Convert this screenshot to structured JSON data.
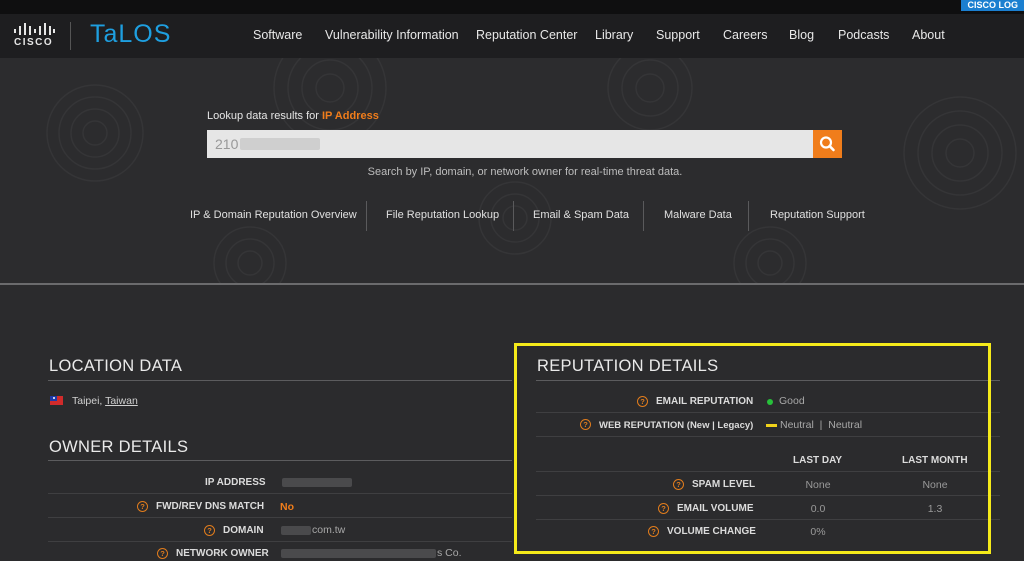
{
  "topbar": {
    "login_label": "CISCO LOG"
  },
  "header": {
    "cisco_wordmark": "CISCO",
    "talos_wordmark": "TaLOS",
    "nav": [
      "Software",
      "Vulnerability Information",
      "Reputation Center",
      "Library",
      "Support",
      "Careers",
      "Blog",
      "Podcasts",
      "About"
    ]
  },
  "lookup": {
    "label_prefix": "Lookup data results for ",
    "label_accent": "IP Address",
    "search_value": "210",
    "hint": "Search by IP, domain, or network owner for real-time threat data."
  },
  "subnav": [
    "IP & Domain Reputation Overview",
    "File Reputation Lookup",
    "Email & Spam Data",
    "Malware Data",
    "Reputation Support"
  ],
  "location": {
    "title": "LOCATION DATA",
    "city": "Taipei, ",
    "country": "Taiwan"
  },
  "owner": {
    "title": "OWNER DETAILS",
    "rows": [
      {
        "label": "IP ADDRESS",
        "value": ""
      },
      {
        "label": "FWD/REV DNS MATCH",
        "value": "No"
      },
      {
        "label": "DOMAIN",
        "value": "com.tw"
      },
      {
        "label": "NETWORK OWNER",
        "value": "s Co."
      }
    ]
  },
  "reputation": {
    "title": "REPUTATION DETAILS",
    "email_label": "EMAIL REPUTATION",
    "email_value": "Good",
    "web_label": "WEB REPUTATION (New | Legacy)",
    "web_value": "Neutral  |  Neutral",
    "columns": [
      "LAST DAY",
      "LAST MONTH"
    ],
    "rows": [
      {
        "label": "SPAM LEVEL",
        "last_day": "None",
        "last_month": "None"
      },
      {
        "label": "EMAIL VOLUME",
        "last_day": "0.0",
        "last_month": "1.3"
      },
      {
        "label": "VOLUME CHANGE",
        "last_day": "0%",
        "last_month": ""
      }
    ]
  },
  "colors": {
    "accent": "#f07d1b",
    "talos_blue": "#1e9fe0",
    "highlight": "#f5ea1a",
    "good": "#27c03a",
    "neutral": "#f0d21a"
  }
}
